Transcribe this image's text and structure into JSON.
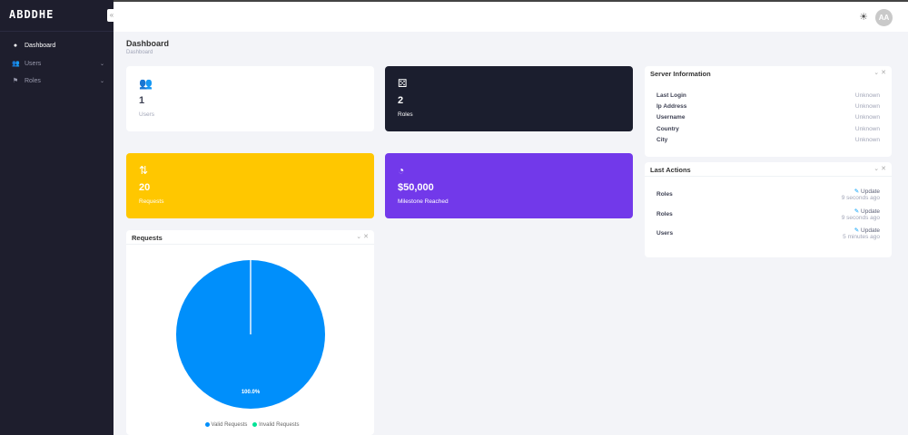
{
  "brand": "ABDDHE",
  "sidebar": {
    "items": [
      {
        "label": "Dashboard",
        "icon": "info-icon"
      },
      {
        "label": "Users",
        "icon": "users-icon"
      },
      {
        "label": "Roles",
        "icon": "roles-icon"
      }
    ]
  },
  "topbar": {
    "avatar": "AA"
  },
  "page": {
    "title": "Dashboard",
    "breadcrumb": "Dashboard"
  },
  "cards": [
    {
      "value": "1",
      "label": "Users",
      "color": "#ffffff"
    },
    {
      "value": "2",
      "label": "Roles",
      "color": "#1b1e2e"
    },
    {
      "value": "20",
      "label": "Requests",
      "color": "#ffc700"
    },
    {
      "value": "$50,000",
      "label": "Milestone Reached",
      "color": "#7239ea"
    }
  ],
  "server": {
    "title": "Server Information",
    "rows": [
      {
        "k": "Last Login",
        "v": "Unknown"
      },
      {
        "k": "Ip Address",
        "v": "Unknown"
      },
      {
        "k": "Username",
        "v": "Unknown"
      },
      {
        "k": "Country",
        "v": "Unknown"
      },
      {
        "k": "City",
        "v": "Unknown"
      }
    ]
  },
  "actions": {
    "title": "Last Actions",
    "rows": [
      {
        "k": "Roles",
        "action": "Update",
        "time": "9 seconds ago"
      },
      {
        "k": "Roles",
        "action": "Update",
        "time": "9 seconds ago"
      },
      {
        "k": "Users",
        "action": "Update",
        "time": "5 minutes ago"
      }
    ]
  },
  "chart_data": {
    "type": "pie",
    "title": "Requests",
    "categories": [
      "Valid Requests",
      "Invalid Requests"
    ],
    "values": [
      20,
      0
    ],
    "colors": [
      "#008ffb",
      "#00e396"
    ],
    "data_labels": [
      "100.0%"
    ]
  }
}
